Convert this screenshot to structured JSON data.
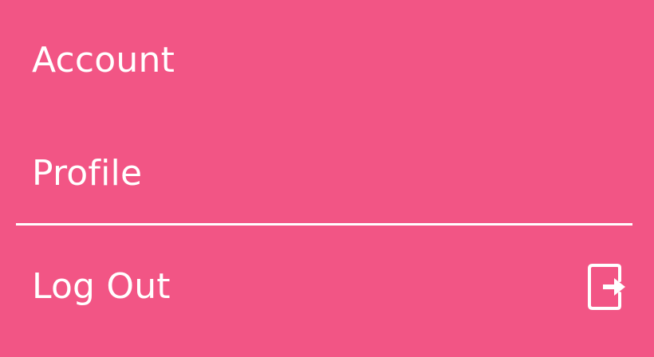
{
  "menu": {
    "items": [
      {
        "label": "Account"
      },
      {
        "label": "Profile"
      },
      {
        "label": "Log Out",
        "icon": "logout-icon"
      }
    ]
  },
  "colors": {
    "background": "#f25585",
    "foreground": "#ffffff"
  }
}
